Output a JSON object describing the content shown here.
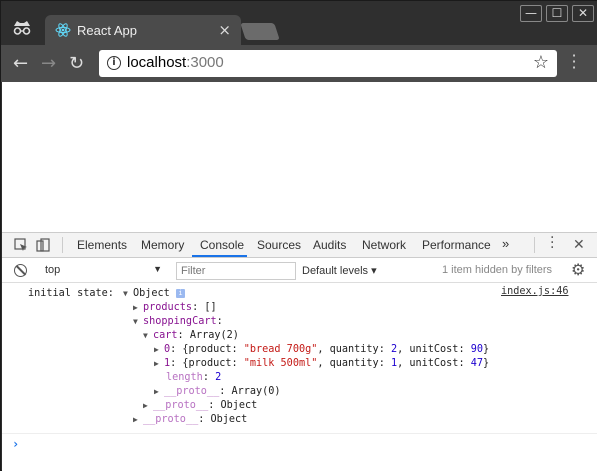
{
  "browser": {
    "tab_title": "React App",
    "tab_close": "×",
    "window_controls": [
      "—",
      "☐",
      "✕"
    ],
    "url_host": "localhost",
    "url_port": ":3000",
    "info_glyph": "i",
    "star_glyph": "☆"
  },
  "devtools": {
    "tabs": [
      "Elements",
      "Memory",
      "Console",
      "Sources",
      "Audits",
      "Network",
      "Performance"
    ],
    "active_tab": "Console",
    "more_tabs": "»",
    "context": "top",
    "filter_placeholder": "Filter",
    "levels_label": "Default levels ▾",
    "hidden_count": "1 item hidden by filters",
    "colors": {
      "accent": "#1a73e8",
      "key": "#881391",
      "string": "#c41a16",
      "number": "#1c00cf"
    }
  },
  "console": {
    "label": "initial state:",
    "source": "index.js:46",
    "root": "Object",
    "info_badge": "i",
    "lines": {
      "products_key": "products",
      "products_val": ": []",
      "shopping_key": "shoppingCart",
      "shopping_val": ":",
      "cart_key": "cart",
      "cart_val": ": Array(2)",
      "item0_key": "0",
      "item0_a": ": {product: ",
      "item0_prod": "\"bread 700g\"",
      "item0_b": ", quantity: ",
      "item0_qty": "2",
      "item0_c": ", unitCost: ",
      "item0_cost": "90",
      "item0_d": "}",
      "item1_key": "1",
      "item1_a": ": {product: ",
      "item1_prod": "\"milk 500ml\"",
      "item1_b": ", quantity: ",
      "item1_qty": "1",
      "item1_c": ", unitCost: ",
      "item1_cost": "47",
      "item1_d": "}",
      "length_key": "length",
      "length_val": "2",
      "proto_key": "__proto__",
      "proto_cart_val": ": Array(0)",
      "proto_cart_obj_val": ": Object",
      "proto_root_val": ": Object"
    },
    "prompt": "›"
  }
}
